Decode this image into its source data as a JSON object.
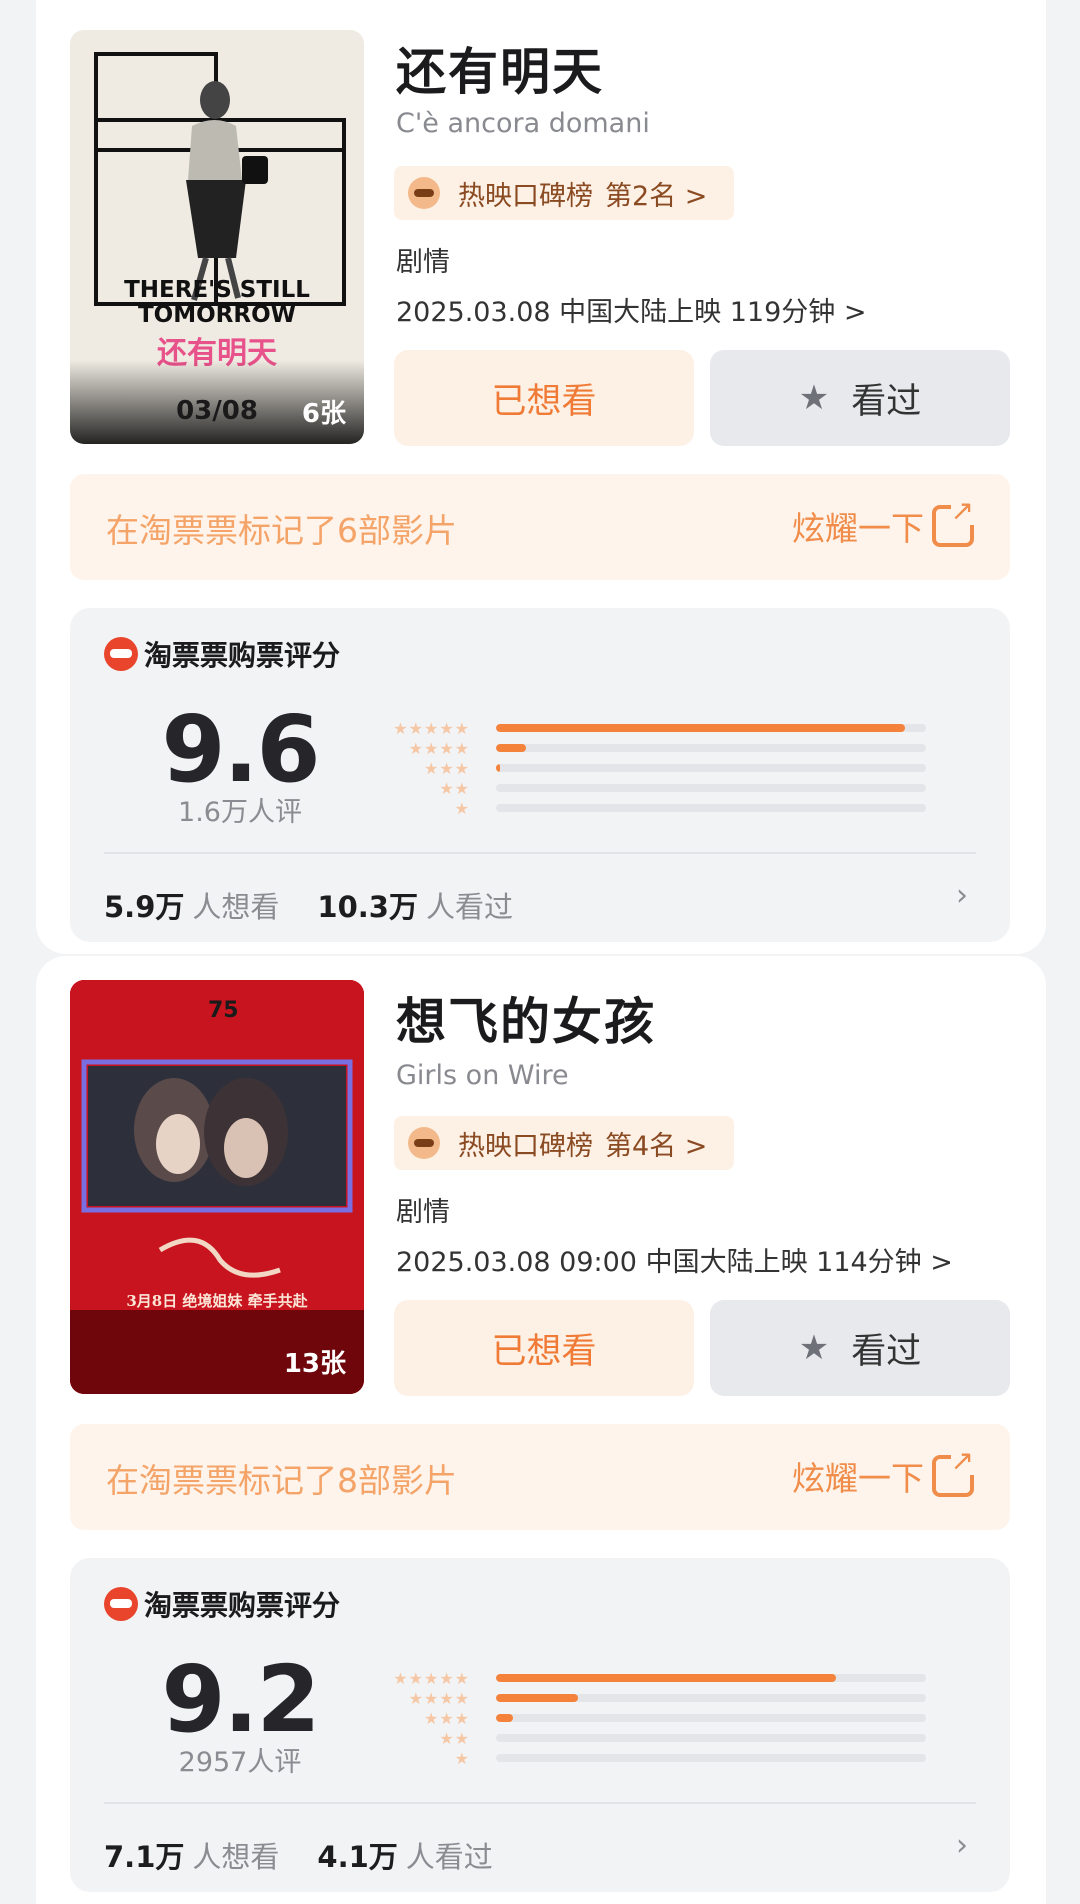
{
  "movies": [
    {
      "title": "还有明天",
      "original_title": "C'è ancora domani",
      "rank_label": "热映口碑榜",
      "rank_pos": "第2名 >",
      "genre": "剧情",
      "release": "2025.03.08 中国大陆上映 119分钟 >",
      "poster_count": "6张",
      "poster_texts": {
        "line1": "THERE'S STILL",
        "line2": "TOMORROW",
        "cn": "还有明天",
        "date": "03/08"
      },
      "want_label": "已想看",
      "seen_label": "看过",
      "marked_text": "在淘票票标记了6部影片",
      "share_label": "炫耀一下",
      "rating_title": "淘票票购票评分",
      "score": "9.6",
      "raters": "1.6万人评",
      "distribution": [
        0.95,
        0.07,
        0.01,
        0.0,
        0.0
      ],
      "want_count": "5.9万",
      "want_suffix": "人想看",
      "seen_count": "10.3万",
      "seen_suffix": "人看过"
    },
    {
      "title": "想飞的女孩",
      "original_title": "Girls on Wire",
      "rank_label": "热映口碑榜",
      "rank_pos": "第4名 >",
      "genre": "剧情",
      "release": "2025.03.08 09:00 中国大陆上映 114分钟 >",
      "poster_count": "13张",
      "poster_texts": {
        "top": "75",
        "date_line": "3月8日 绝境姐妹 牵手共赴"
      },
      "want_label": "已想看",
      "seen_label": "看过",
      "marked_text": "在淘票票标记了8部影片",
      "share_label": "炫耀一下",
      "rating_title": "淘票票购票评分",
      "score": "9.2",
      "raters": "2957人评",
      "distribution": [
        0.79,
        0.19,
        0.04,
        0.0,
        0.0
      ],
      "want_count": "7.1万",
      "want_suffix": "人想看",
      "seen_count": "4.1万",
      "seen_suffix": "人看过"
    }
  ],
  "star_rows": [
    "★★★★★",
    "★★★★",
    "★★★",
    "★★",
    "★"
  ],
  "colors": {
    "accent": "#f4823a",
    "want_bg": "#fdf1e5",
    "seen_bg": "#e7e9ed"
  }
}
